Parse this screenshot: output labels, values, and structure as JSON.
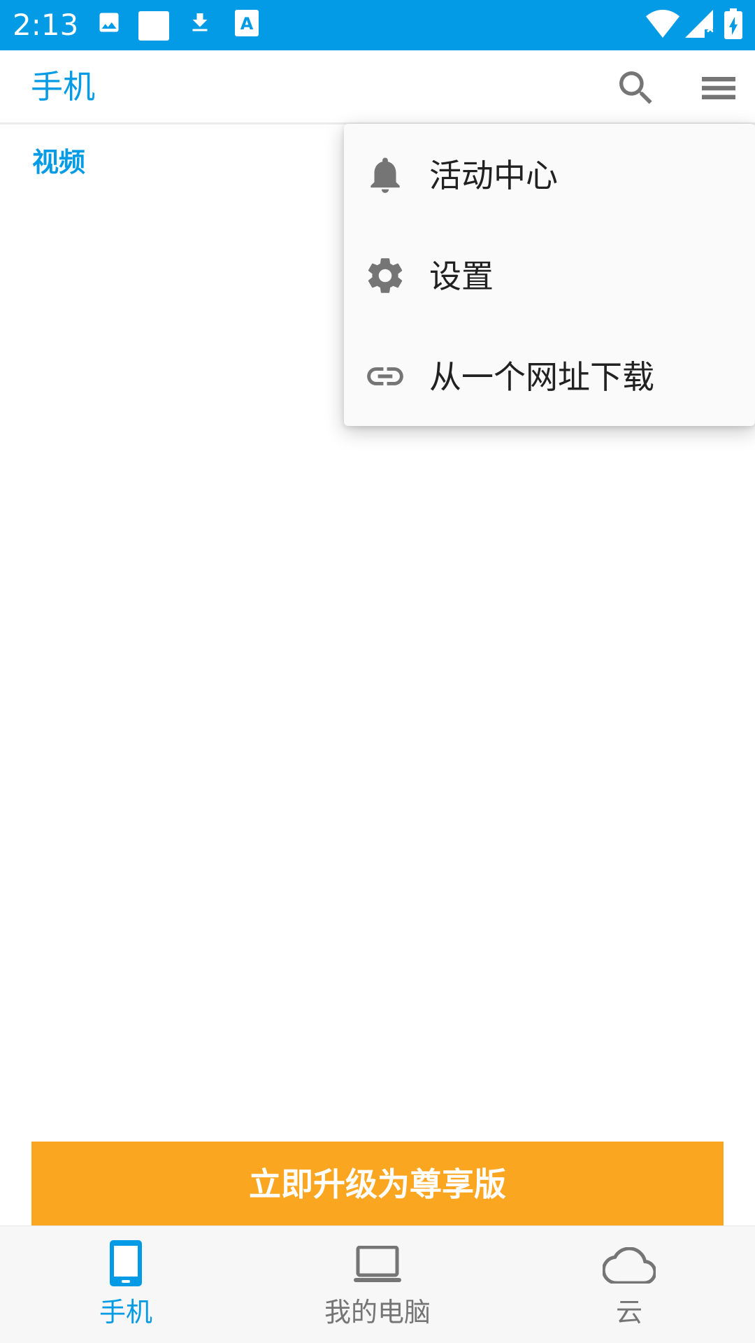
{
  "status_bar": {
    "time": "2:13",
    "notification_icons": [
      "image-icon",
      "blank-square-icon",
      "download-icon",
      "text-a-icon"
    ],
    "system_icons": [
      "wifi-icon",
      "cellular-signal-icon",
      "battery-charging-icon"
    ]
  },
  "app_bar": {
    "title": "手机",
    "search_icon": "search-icon",
    "menu_icon": "hamburger-menu-icon"
  },
  "content": {
    "section_header": "视频"
  },
  "popup_menu": {
    "items": [
      {
        "label": "活动中心",
        "icon": "bell-icon"
      },
      {
        "label": "设置",
        "icon": "gear-icon"
      },
      {
        "label": "从一个网址下载",
        "icon": "link-icon"
      }
    ]
  },
  "upgrade_banner": {
    "label": "立即升级为尊享版"
  },
  "bottom_nav": {
    "items": [
      {
        "label": "手机",
        "icon": "phone-icon",
        "active": true
      },
      {
        "label": "我的电脑",
        "icon": "laptop-icon",
        "active": false
      },
      {
        "label": "云",
        "icon": "cloud-icon",
        "active": false
      }
    ]
  },
  "colors": {
    "primary": "#039BE5",
    "upgrade": "#FBA621",
    "icon_gray": "#757575",
    "menu_bg": "#FAFAFA"
  }
}
